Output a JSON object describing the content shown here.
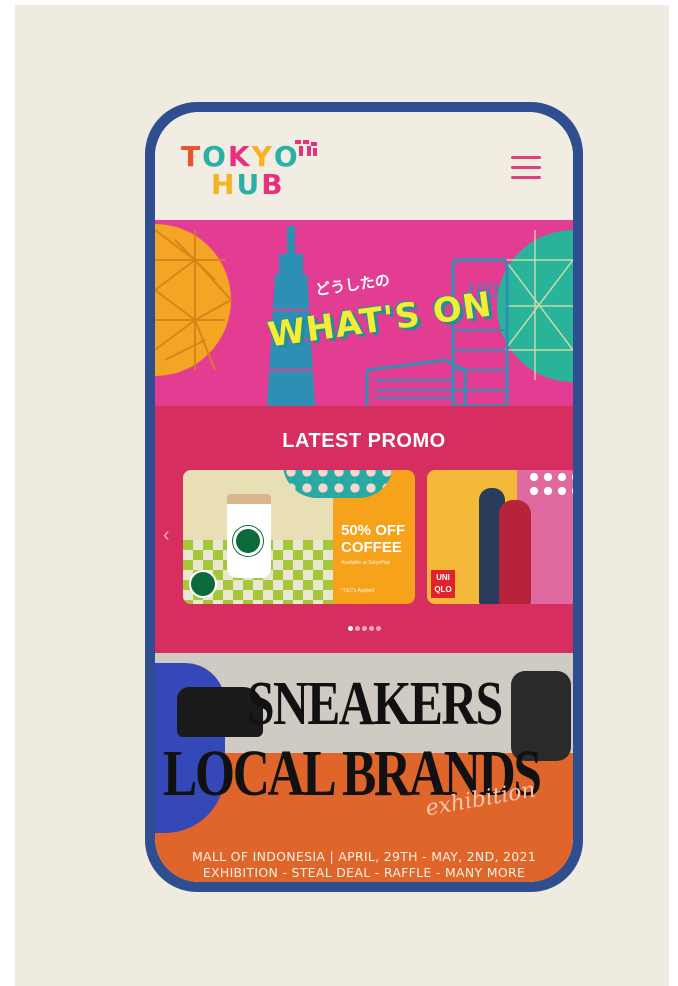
{
  "header": {
    "logo": {
      "line1": [
        "T",
        "O",
        "K",
        "Y",
        "O"
      ],
      "line2": [
        "H",
        "U",
        "B"
      ]
    },
    "menu_icon": "hamburger-menu-icon"
  },
  "banner": {
    "jp_text": "どうしたの",
    "title": "WHAT'S ON"
  },
  "promo": {
    "title": "LATEST PROMO",
    "cards": [
      {
        "brand": "starbucks",
        "headline_1": "50% OFF",
        "headline_2": "COFFEE",
        "subtext": "Available at TokyoHub",
        "tnc": "*T&C's Applied"
      },
      {
        "brand": "uniqlo",
        "logo_1": "UNI",
        "logo_2": "QLO"
      }
    ],
    "dots": 5,
    "active_dot": 0
  },
  "event": {
    "title_1": "SNEAKERS",
    "title_2": "LOCAL BRANDS",
    "script": "exhibition",
    "info_1": "MALL OF INDONESIA | APRIL, 29TH - MAY, 2ND, 2021",
    "info_2": "EXHIBITION - STEAL DEAL - RAFFLE - MANY MORE"
  },
  "colors": {
    "background": "#efebe0",
    "phone_frame": "#2e4e8f",
    "banner_pink": "#e23d92",
    "promo_red": "#d62e5e",
    "menu_pink": "#de3f7d",
    "event_orange": "#e0652b"
  }
}
